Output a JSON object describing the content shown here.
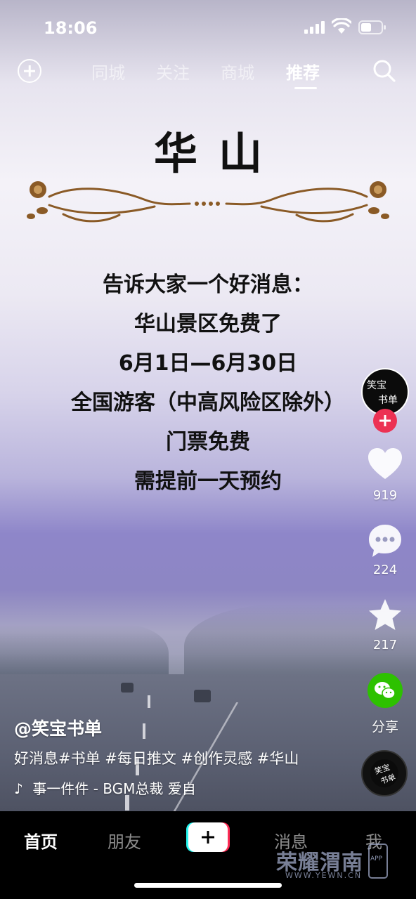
{
  "status_bar": {
    "time": "18:06"
  },
  "top_nav": {
    "tabs": [
      {
        "label": "同城",
        "active": false
      },
      {
        "label": "关注",
        "active": false
      },
      {
        "label": "商城",
        "active": false
      },
      {
        "label": "推荐",
        "active": true
      }
    ]
  },
  "poster": {
    "title": "华山",
    "lines": [
      "告诉大家一个好消息：",
      "华山景区免费了",
      "6月1日—6月30日",
      "全国游客（中高风险区除外）",
      "门票免费",
      "需提前一天预约"
    ]
  },
  "right_rail": {
    "avatar_text_line1": "笑宝",
    "avatar_text_line2": "书单",
    "likes": "919",
    "comments": "224",
    "favorites": "217",
    "share_label": "分享",
    "disc_text_1": "笑宝",
    "disc_text_2": "书单"
  },
  "caption": {
    "author": "@笑宝书单",
    "text": "好消息#书单 #每日推文 #创作灵感 #华山",
    "music": "事一件件 - BGM总裁    爱自"
  },
  "tab_bar": {
    "items": [
      {
        "label": "首页",
        "active": true
      },
      {
        "label": "朋友",
        "active": false
      },
      {
        "label": "消息",
        "active": false
      },
      {
        "label": "我",
        "active": false
      }
    ]
  },
  "watermark": {
    "title": "荣耀渭南",
    "url": "WWW.YEWN.CN",
    "badge": "APP"
  },
  "colors": {
    "accent_red": "#ec3153",
    "wechat_green": "#2dc100",
    "create_cyan": "#25f4ee",
    "create_red": "#fe2c55"
  },
  "icons": [
    "add-circle-icon",
    "search-icon",
    "heart-icon",
    "comment-icon",
    "star-icon",
    "wechat-share-icon",
    "music-note-icon",
    "plus-icon"
  ]
}
